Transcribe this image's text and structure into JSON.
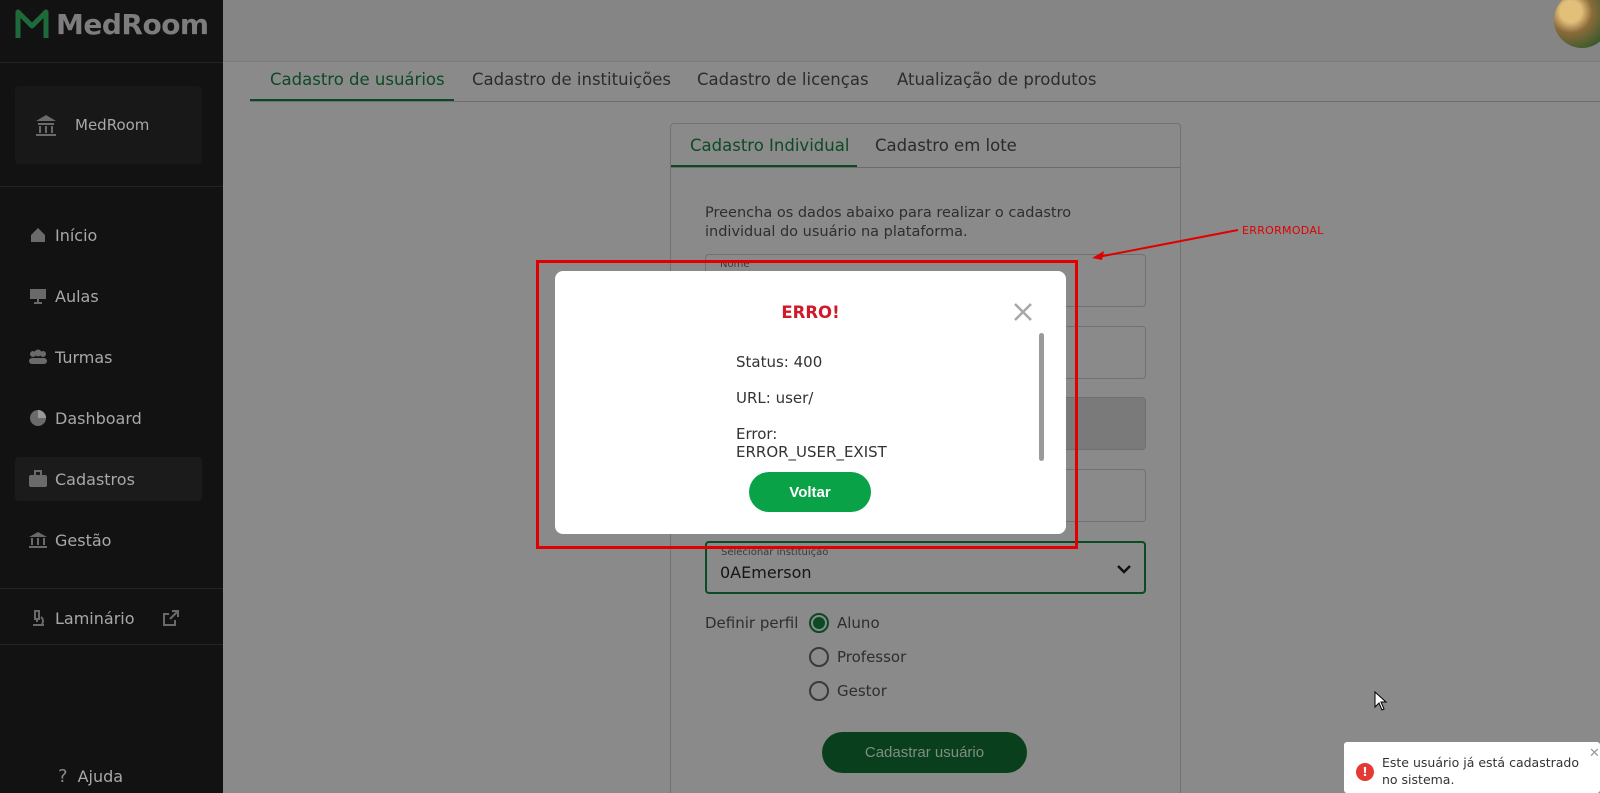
{
  "app": {
    "brand": "MedRoom"
  },
  "sidebar": {
    "institution": "MedRoom",
    "items": [
      {
        "label": "Início",
        "icon": "home-icon"
      },
      {
        "label": "Aulas",
        "icon": "presentation-icon"
      },
      {
        "label": "Turmas",
        "icon": "group-icon"
      },
      {
        "label": "Dashboard",
        "icon": "pie-chart-icon"
      },
      {
        "label": "Cadastros",
        "icon": "briefcase-icon",
        "active": true
      },
      {
        "label": "Gestão",
        "icon": "bank-icon"
      }
    ],
    "laminario": "Laminário",
    "help": "Ajuda"
  },
  "tabs": [
    "Cadastro de usuários",
    "Cadastro de instituições",
    "Cadastro de licenças",
    "Atualização de produtos"
  ],
  "form": {
    "subtabs": [
      "Cadastro Individual",
      "Cadastro em lote"
    ],
    "description": "Preencha os dados abaixo para realizar o cadastro individual do usuário na plataforma.",
    "name_label": "Nome",
    "institution_label": "Selecionar instituição",
    "institution_value": "0AEmerson",
    "profile_label": "Definir perfil",
    "profiles": [
      "Aluno",
      "Professor",
      "Gestor"
    ],
    "selected_profile": "Aluno",
    "submit": "Cadastrar usuário"
  },
  "annotation": {
    "label": "ERRORMODAL",
    "color": "#e00000"
  },
  "modal": {
    "title": "ERRO!",
    "status": "Status: 400",
    "url": "URL: user/",
    "error_label": "Error:",
    "error_value": "ERROR_USER_EXIST",
    "button": "Voltar"
  },
  "toast": {
    "message": "Este usuário já está cadastrado no sistema.",
    "icon": "!"
  },
  "colors": {
    "accent": "#0aa247",
    "error": "#d0192a",
    "sidebar": "#121212"
  }
}
